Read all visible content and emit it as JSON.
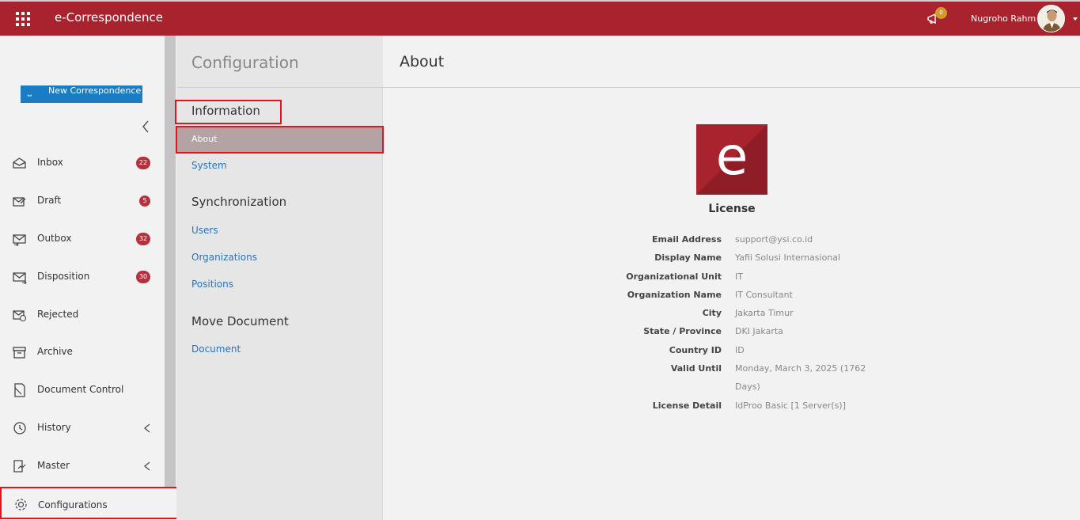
{
  "header": {
    "app_title": "e-Correspondence",
    "user_name": "Nugroho Rahm",
    "notification_count": "0",
    "accent_color": "#a8232e"
  },
  "sidebar": {
    "new_button_label": "New Correspondence",
    "items": [
      {
        "label": "Inbox",
        "badge": "22",
        "icon": "inbox-icon"
      },
      {
        "label": "Draft",
        "badge": "5",
        "icon": "draft-icon"
      },
      {
        "label": "Outbox",
        "badge": "32",
        "icon": "outbox-icon"
      },
      {
        "label": "Disposition",
        "badge": "30",
        "icon": "disposition-icon"
      },
      {
        "label": "Rejected",
        "badge": "",
        "icon": "rejected-icon"
      },
      {
        "label": "Archive",
        "badge": "",
        "icon": "archive-icon"
      },
      {
        "label": "Document Control",
        "badge": "",
        "icon": "document-control-icon"
      },
      {
        "label": "History",
        "badge": "",
        "icon": "history-icon"
      },
      {
        "label": "Master",
        "badge": "",
        "icon": "master-icon"
      }
    ],
    "configurations_label": "Configurations"
  },
  "config_panel": {
    "title": "Configuration",
    "sections": [
      {
        "heading": "Information",
        "links": [
          "About",
          "System"
        ]
      },
      {
        "heading": "Synchronization",
        "links": [
          "Users",
          "Organizations",
          "Positions"
        ]
      },
      {
        "heading": "Move Document",
        "links": [
          "Document"
        ]
      }
    ],
    "active_link": "About"
  },
  "main": {
    "title": "About",
    "logo_letter": "e",
    "license_title": "License",
    "fields": [
      {
        "label": "Email Address",
        "value": "support@ysi.co.id"
      },
      {
        "label": "Display Name",
        "value": "Yafii Solusi Internasional"
      },
      {
        "label": "Organizational Unit",
        "value": "IT"
      },
      {
        "label": "Organization Name",
        "value": "IT Consultant"
      },
      {
        "label": "City",
        "value": "Jakarta Timur"
      },
      {
        "label": "State / Province",
        "value": "DKI Jakarta"
      },
      {
        "label": "Country ID",
        "value": "ID"
      },
      {
        "label": "Valid Until",
        "value": "Monday, March 3, 2025 (1762",
        "value_cont": "Days)"
      },
      {
        "label": "License Detail",
        "value": "IdProo Basic [1 Server(s)]"
      }
    ]
  }
}
